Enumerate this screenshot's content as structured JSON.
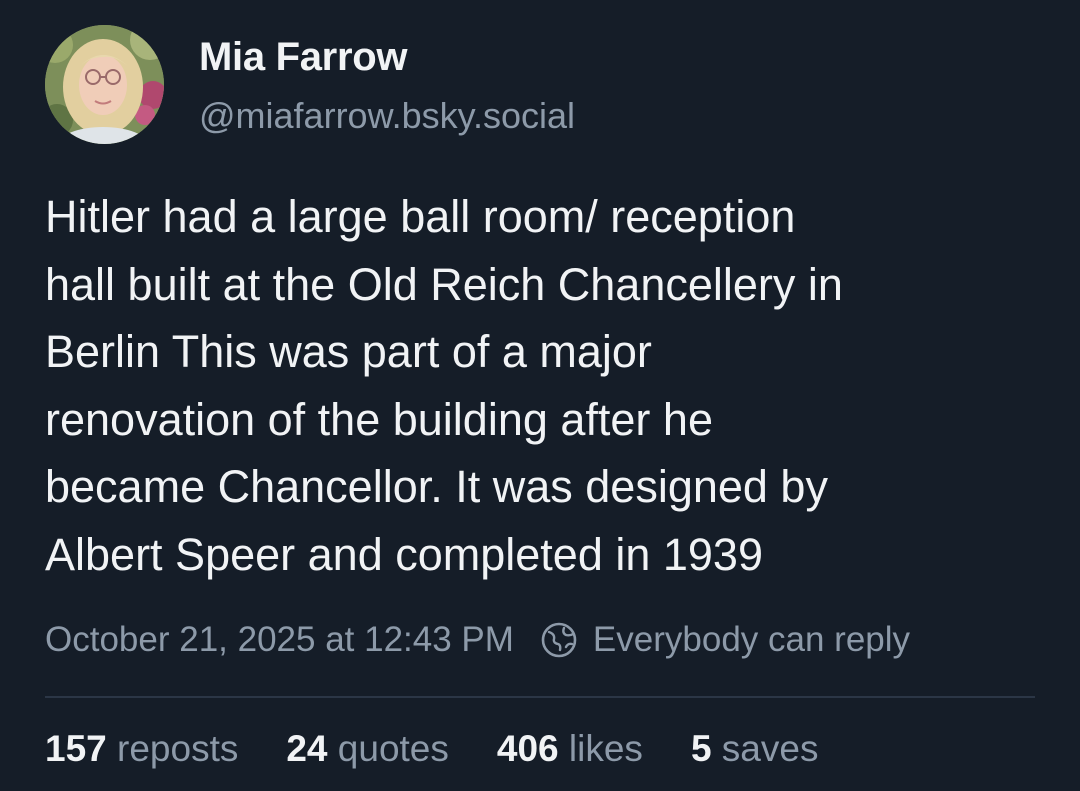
{
  "author": {
    "name": "Mia Farrow",
    "handle": "@miafarrow.bsky.social",
    "avatar_icon": "profile-photo"
  },
  "post": {
    "text": "Hitler had a large ball room/ reception\nhall built at the Old Reich Chancellery in\nBerlin This was part of a major\nrenovation of the building after he\nbecame Chancellor. It was designed by\nAlbert Speer and completed in 1939",
    "timestamp": "October 21, 2025 at 12:43 PM",
    "reply_setting": "Everybody can reply",
    "reply_icon": "globe-icon"
  },
  "stats": [
    {
      "count": "157",
      "label": "reposts"
    },
    {
      "count": "24",
      "label": "quotes"
    },
    {
      "count": "406",
      "label": "likes"
    },
    {
      "count": "5",
      "label": "saves"
    }
  ],
  "colors": {
    "background": "#151d28",
    "text_primary": "#f1f3f5",
    "text_secondary": "#8d9aa9",
    "divider": "#2b3646"
  }
}
